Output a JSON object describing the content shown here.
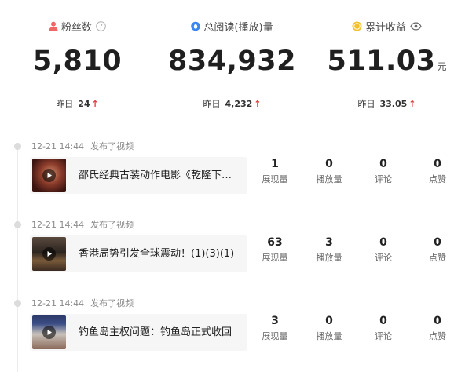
{
  "stats": [
    {
      "label": "粉丝数",
      "value": "5,810",
      "unit": "",
      "yesterday_label": "昨日",
      "yesterday_value": "24",
      "icon": "user-icon",
      "tail_icon": "help-icon",
      "accent": "#f06767"
    },
    {
      "label": "总阅读(播放)量",
      "value": "834,932",
      "unit": "",
      "yesterday_label": "昨日",
      "yesterday_value": "4,232",
      "icon": "drop-icon",
      "tail_icon": "",
      "accent": "#3b86f0"
    },
    {
      "label": "累计收益",
      "value": "511.03",
      "unit": "元",
      "yesterday_label": "昨日",
      "yesterday_value": "33.05",
      "icon": "coin-icon",
      "tail_icon": "eye-icon",
      "accent": "#f2c12e"
    }
  ],
  "up_arrow_color": "#e23b3b",
  "feed": [
    {
      "time": "12-21 14:44",
      "action": "发布了视频",
      "title": "邵氏经典古装动作电影《乾隆下江南》",
      "metrics": [
        {
          "value": "1",
          "label": "展现量"
        },
        {
          "value": "0",
          "label": "播放量"
        },
        {
          "value": "0",
          "label": "评论"
        },
        {
          "value": "0",
          "label": "点赞"
        }
      ]
    },
    {
      "time": "12-21 14:44",
      "action": "发布了视频",
      "title": "香港局势引发全球震动！(1)(3)(1)",
      "metrics": [
        {
          "value": "63",
          "label": "展现量"
        },
        {
          "value": "3",
          "label": "播放量"
        },
        {
          "value": "0",
          "label": "评论"
        },
        {
          "value": "0",
          "label": "点赞"
        }
      ]
    },
    {
      "time": "12-21 14:44",
      "action": "发布了视频",
      "title": "钓鱼岛主权问题：钓鱼岛正式收回",
      "metrics": [
        {
          "value": "3",
          "label": "展现量"
        },
        {
          "value": "0",
          "label": "播放量"
        },
        {
          "value": "0",
          "label": "评论"
        },
        {
          "value": "0",
          "label": "点赞"
        }
      ]
    }
  ]
}
